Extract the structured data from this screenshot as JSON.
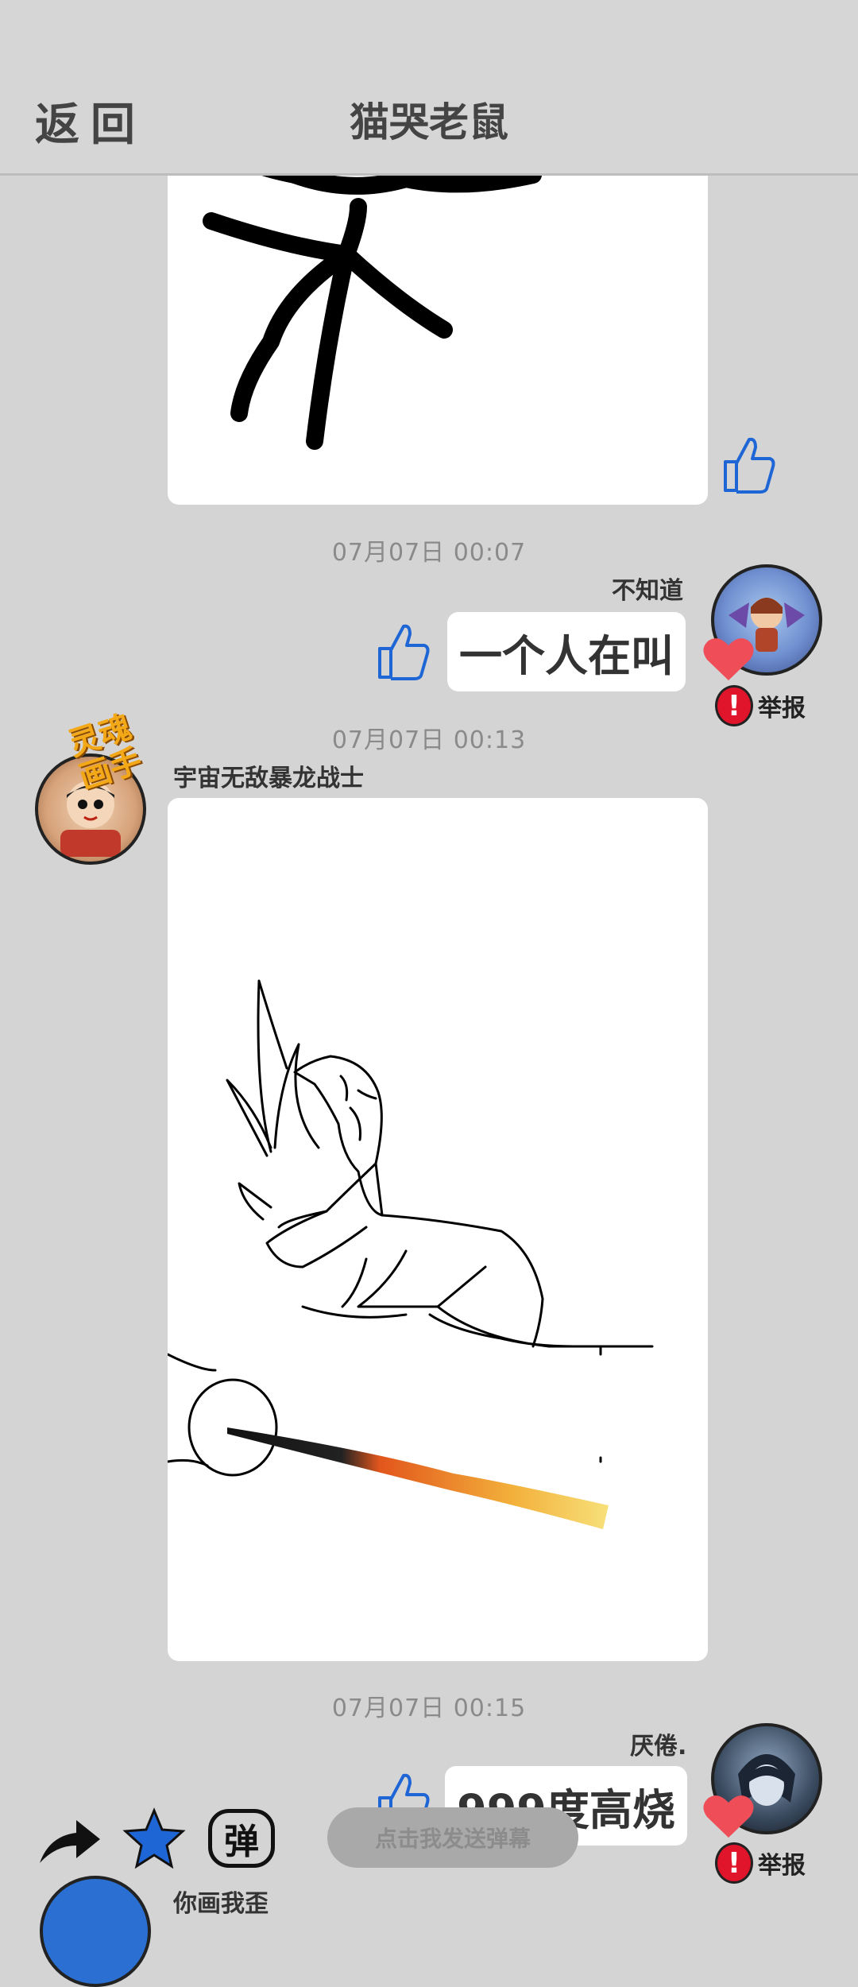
{
  "header": {
    "back_label": "返回",
    "title": "猫哭老鼠"
  },
  "messages": [
    {
      "timestamp": "07月07日  00:07",
      "username": "不知道",
      "text": "一个人在叫",
      "report_label": "举报"
    },
    {
      "timestamp": "07月07日  00:13",
      "username": "宇宙无敌暴龙战士",
      "badge_text": "灵魂画手"
    },
    {
      "timestamp": "07月07日  00:15",
      "username": "厌倦.",
      "text": "999度高烧",
      "report_label": "举报"
    }
  ],
  "bottom": {
    "danmu_placeholder": "点击我发送弹幕",
    "danmu_icon_text": "弹",
    "next_username": "你画我歪"
  },
  "colors": {
    "accent_blue": "#1e66d6",
    "heart": "#ef4d57",
    "report": "#e0142a"
  },
  "icons": [
    "thumbs-up-icon",
    "heart-icon",
    "alert-icon",
    "share-icon",
    "star-icon",
    "danmu-icon"
  ]
}
